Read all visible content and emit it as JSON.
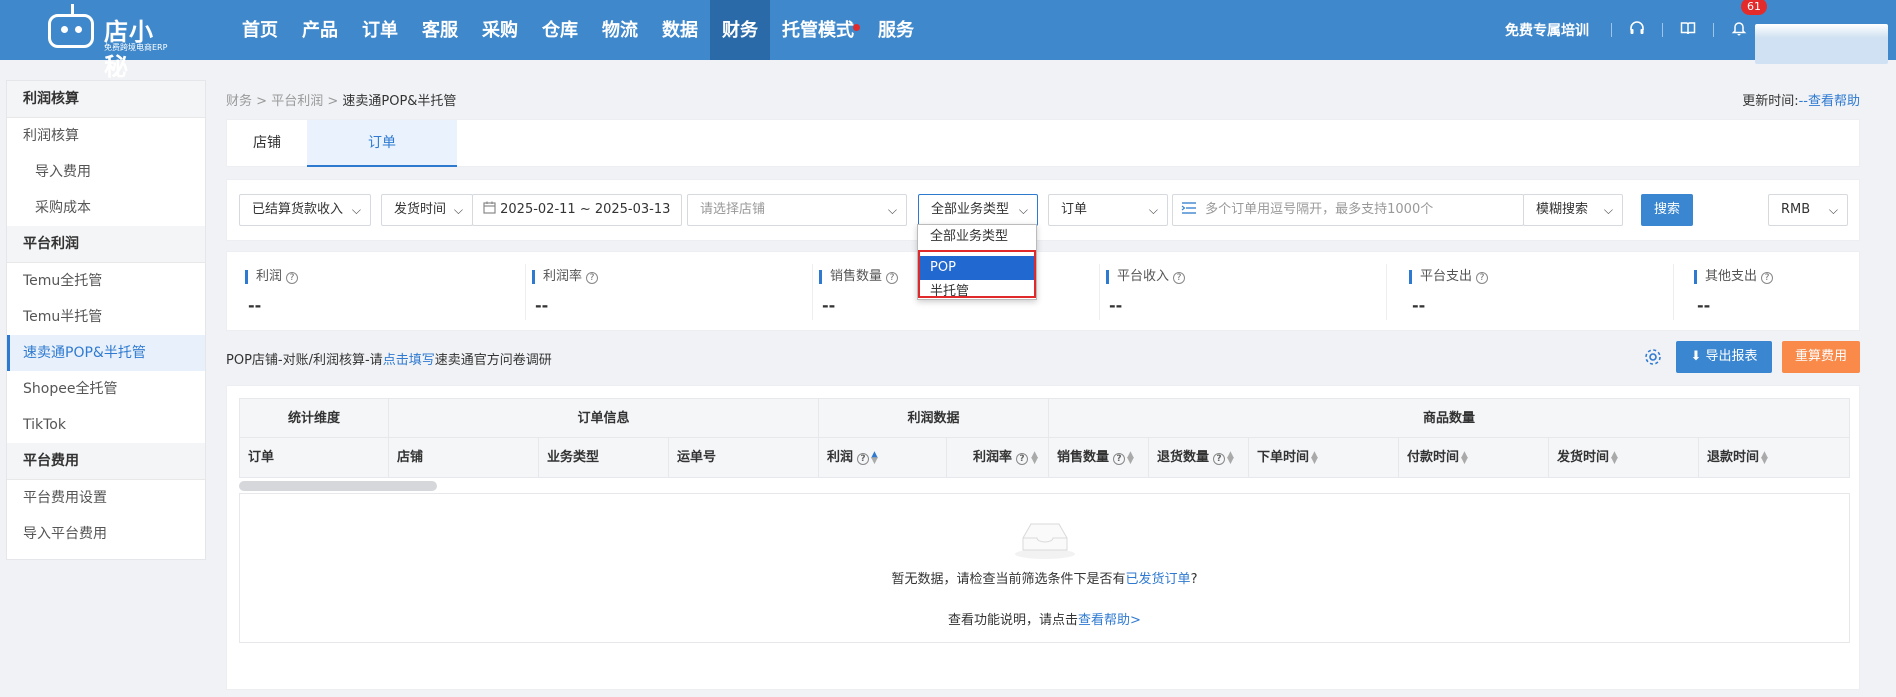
{
  "logo": {
    "name": "店小秘",
    "subtitle": "免费跨境电商ERP"
  },
  "nav": [
    {
      "label": "首页"
    },
    {
      "label": "产品"
    },
    {
      "label": "订单"
    },
    {
      "label": "客服"
    },
    {
      "label": "采购"
    },
    {
      "label": "仓库"
    },
    {
      "label": "物流"
    },
    {
      "label": "数据"
    },
    {
      "label": "财务",
      "active": true
    },
    {
      "label": "托管模式",
      "dot": true
    },
    {
      "label": "服务"
    }
  ],
  "topright": {
    "training": "免费专属培训",
    "notification_count": "61"
  },
  "sidebar": {
    "groups": [
      {
        "title": "利润核算",
        "items": [
          {
            "label": "利润核算"
          },
          {
            "label": "导入费用",
            "sub": true
          },
          {
            "label": "采购成本",
            "sub": true
          }
        ]
      },
      {
        "title": "平台利润",
        "items": [
          {
            "label": "Temu全托管"
          },
          {
            "label": "Temu半托管"
          },
          {
            "label": "速卖通POP&半托管",
            "active": true
          },
          {
            "label": "Shopee全托管"
          },
          {
            "label": "TikTok"
          }
        ]
      },
      {
        "title": "平台费用",
        "items": [
          {
            "label": "平台费用设置"
          },
          {
            "label": "导入平台费用"
          }
        ]
      }
    ]
  },
  "breadcrumb": {
    "l1": "财务",
    "l2": "平台利润",
    "current": "速卖通POP&半托管"
  },
  "update": {
    "label": "更新时间:",
    "value": "--",
    "link": "查看帮助"
  },
  "tabs": [
    {
      "label": "店铺"
    },
    {
      "label": "订单",
      "active": true
    }
  ],
  "filters": {
    "income_type": "已结算货款收入",
    "time_type": "发货时间",
    "date_range": "2025-02-11 ~ 2025-03-13",
    "shop_placeholder": "请选择店铺",
    "business_type": "全部业务类型",
    "search_type": "订单",
    "search_placeholder": "多个订单用逗号隔开，最多支持1000个",
    "match_mode": "模糊搜索",
    "search_button": "搜索",
    "currency": "RMB"
  },
  "business_dropdown": {
    "options": [
      "全部业务类型",
      "POP",
      "半托管"
    ],
    "selected": "POP"
  },
  "stats": [
    {
      "label": "利润",
      "value": "--"
    },
    {
      "label": "利润率",
      "value": "--"
    },
    {
      "label": "销售数量",
      "value": "--"
    },
    {
      "label": "平台收入",
      "value": "--"
    },
    {
      "label": "平台支出",
      "value": "--"
    },
    {
      "label": "其他支出",
      "value": "--"
    }
  ],
  "notice": {
    "pre": "POP店铺-对账/利润核算-请",
    "link": "点击填写",
    "post": "速卖通官方问卷调研"
  },
  "actions": {
    "export": "导出报表",
    "reset": "重算费用"
  },
  "table": {
    "groups": [
      "统计维度",
      "订单信息",
      "利润数据",
      "商品数量"
    ],
    "columns": [
      "订单",
      "店铺",
      "业务类型",
      "运单号",
      "利润",
      "利润率",
      "销售数量",
      "退货数量",
      "下单时间",
      "付款时间",
      "发货时间",
      "退款时间"
    ]
  },
  "empty": {
    "line1_pre": "暂无数据，请检查当前筛选条件下是否有",
    "line1_link": "已发货订单",
    "line1_post": "?",
    "line2_pre": "查看功能说明，请点击",
    "line2_link": "查看帮助>"
  },
  "colors": {
    "topbar": "#3f88cb",
    "accent": "#2f7ad1",
    "reset_button": "#f98a4a",
    "highlight_box": "#e0292b"
  }
}
